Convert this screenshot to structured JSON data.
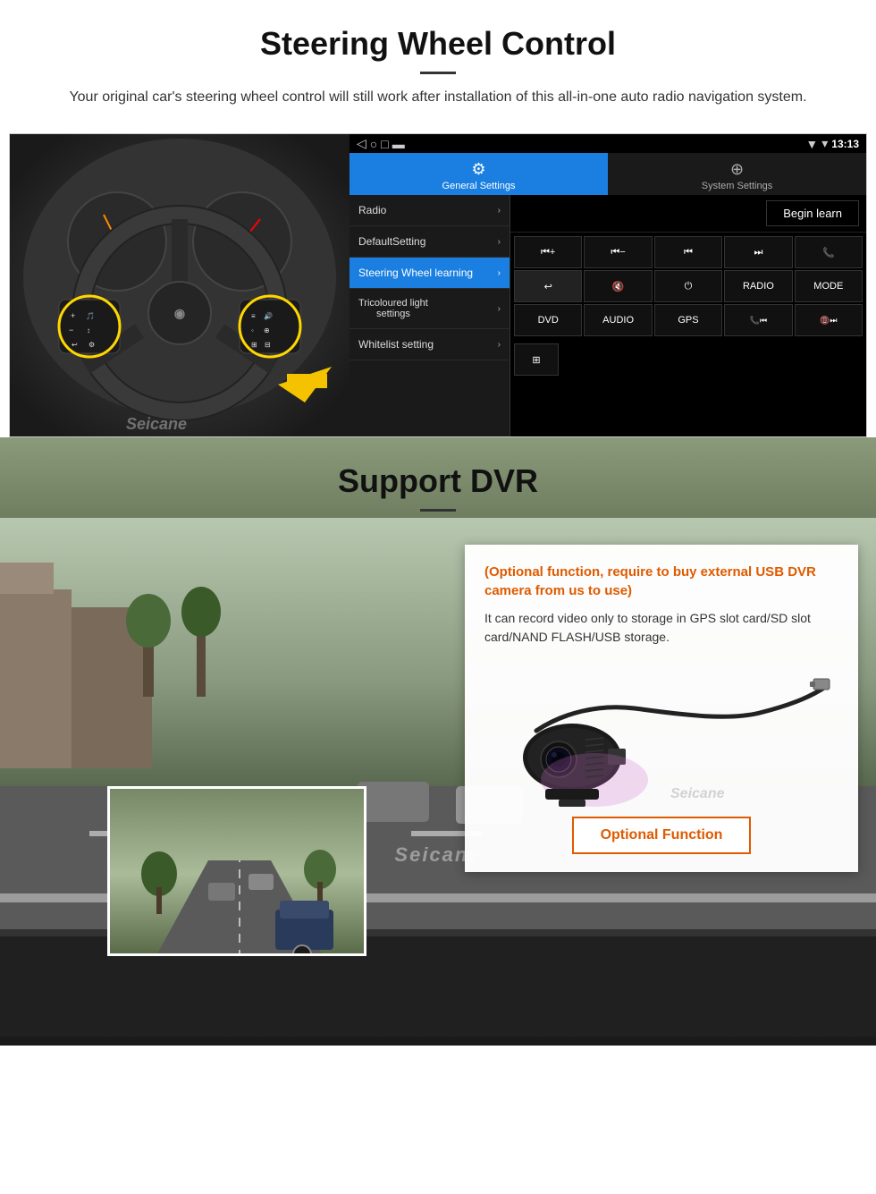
{
  "page": {
    "section1": {
      "title": "Steering Wheel Control",
      "subtitle": "Your original car's steering wheel control will still work after installation of this all-in-one auto radio navigation system.",
      "status_bar": {
        "time": "13:13",
        "icons": [
          "wifi",
          "signal",
          "battery"
        ]
      },
      "tabs": [
        {
          "label": "General Settings",
          "active": true,
          "icon": "⚙"
        },
        {
          "label": "System Settings",
          "active": false,
          "icon": "🔧"
        }
      ],
      "menu_items": [
        {
          "label": "Radio",
          "active": false
        },
        {
          "label": "DefaultSetting",
          "active": false
        },
        {
          "label": "Steering Wheel learning",
          "active": true
        },
        {
          "label": "Tricoloured light settings",
          "active": false
        },
        {
          "label": "Whitelist setting",
          "active": false
        }
      ],
      "begin_learn": "Begin learn",
      "buttons": [
        "⏮+",
        "⏮−",
        "⏮⏮",
        "⏭⏭",
        "📞",
        "📵",
        "🔇",
        "⏻",
        "RADIO",
        "MODE",
        "DVD",
        "AUDIO",
        "GPS",
        "📞⏮",
        "📵⏭"
      ],
      "extra_btn": "⊞"
    },
    "section2": {
      "title": "Support DVR",
      "optional_text": "(Optional function, require to buy external USB DVR camera from us to use)",
      "description": "It can record video only to storage in GPS slot card/SD slot card/NAND FLASH/USB storage.",
      "optional_function_label": "Optional Function",
      "watermark": "Seicane"
    }
  }
}
